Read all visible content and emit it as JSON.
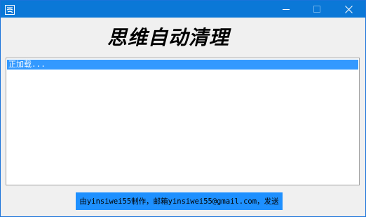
{
  "window": {
    "icon": "app-logo-icon",
    "controls": [
      "minimize-icon",
      "maximize-icon",
      "close-icon"
    ],
    "title_bar_color": "#0b78d7"
  },
  "main": {
    "heading": "思维自动清理"
  },
  "list": {
    "items": [
      "正加载..."
    ],
    "selected_color": "#3399ff"
  },
  "footer": {
    "link_text": "由yinsiwei55制作，邮箱yinsiwei55@gmail.com，发送",
    "link_bg_color": "#1e90ff"
  }
}
